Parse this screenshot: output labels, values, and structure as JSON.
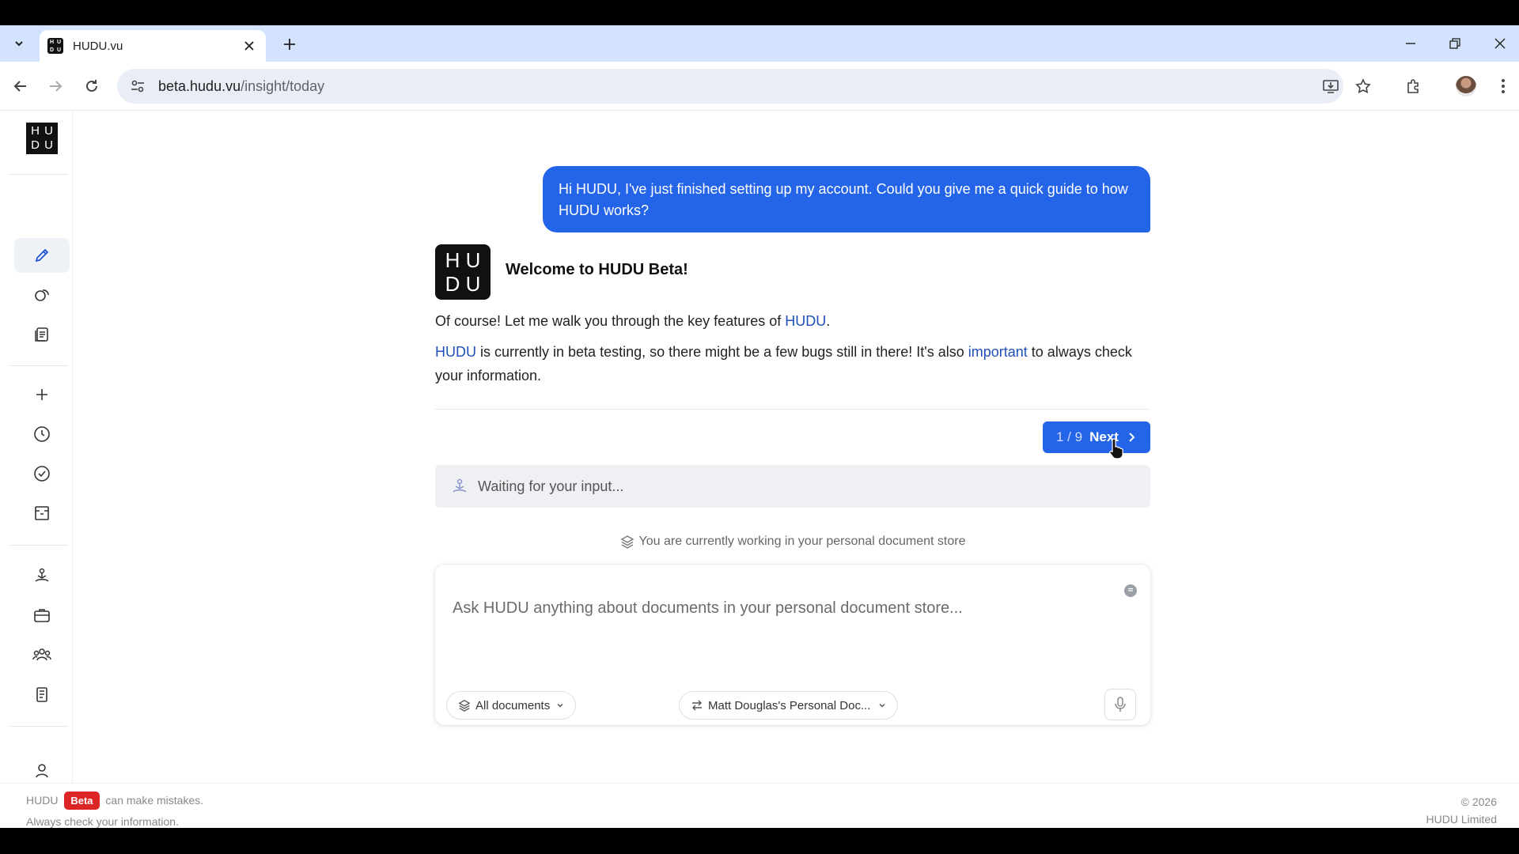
{
  "browser": {
    "tab_title": "HUDU.vu",
    "url_host": "beta.hudu.vu",
    "url_path": "/insight/today"
  },
  "brand": {
    "logo_letters": [
      "H",
      "U",
      "D",
      "U"
    ]
  },
  "chat": {
    "user_message": "Hi HUDU, I've just finished setting up my account. Could you give me a quick guide to how HUDU works?",
    "assistant_title": "Welcome to HUDU Beta!",
    "assistant_p1_before": "Of course! Let me walk you through the key features of ",
    "assistant_p1_hl": "HUDU",
    "assistant_p1_after": ".",
    "assistant_p2_hl1": "HUDU",
    "assistant_p2_mid": " is currently in beta testing, so there might be a few bugs still in there! It's also ",
    "assistant_p2_hl2": "important",
    "assistant_p2_end": " to always check your information.",
    "step_count": "1 / 9",
    "next_label": "Next",
    "waiting_text": "Waiting for your input...",
    "store_note": "You are currently working in your personal document store"
  },
  "composer": {
    "placeholder": "Ask HUDU anything about documents in your personal document store...",
    "documents_filter": "All documents",
    "store_selector": "Matt Douglas's Personal Doc..."
  },
  "footer": {
    "brand": "HUDU",
    "badge": "Beta",
    "mistakes": "can make mistakes.",
    "check": "Always check your information.",
    "year": "© 2026",
    "company": "HUDU Limited"
  },
  "colors": {
    "accent": "#2364e8",
    "badge": "#dc2626"
  }
}
